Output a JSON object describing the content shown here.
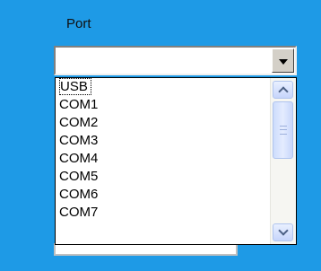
{
  "port": {
    "label": "Port",
    "selected_value": "",
    "options": [
      "USB",
      "COM1",
      "COM2",
      "COM3",
      "COM4",
      "COM5",
      "COM6",
      "COM7"
    ]
  },
  "icons": {
    "dropdown": "triangle-down-icon",
    "scroll_up": "chevron-up-icon",
    "scroll_down": "chevron-down-icon"
  },
  "colors": {
    "background": "#1e9ae6",
    "scrollbar_accent": "#c6d5fb"
  }
}
